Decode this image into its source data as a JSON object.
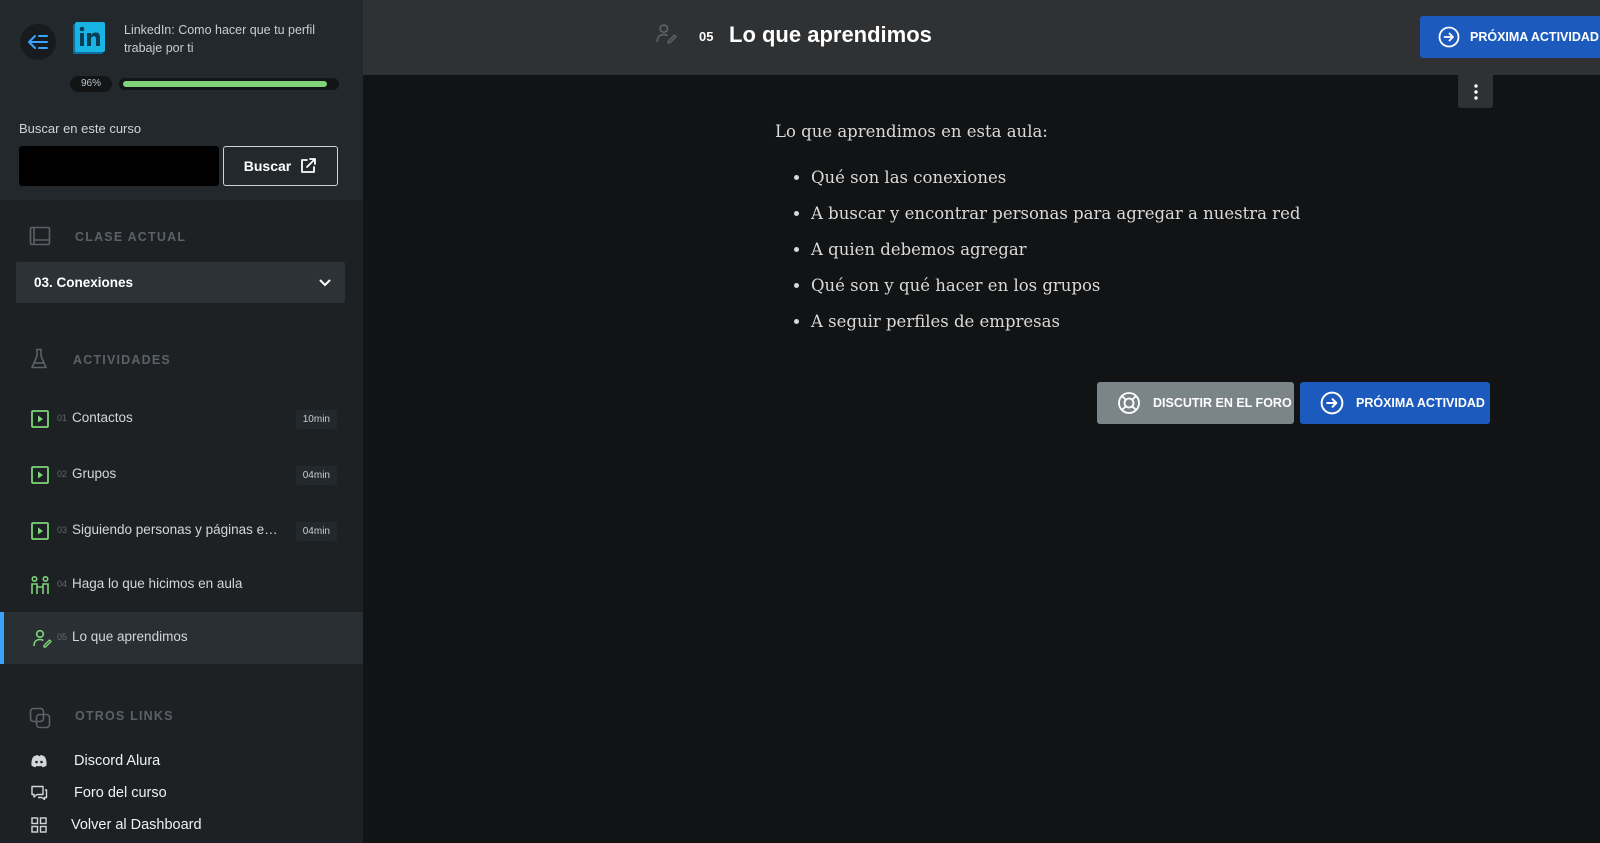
{
  "course": {
    "title": "LinkedIn: Como hacer que tu perfil trabaje por ti",
    "progress_label": "96%",
    "progress_value": 0.96
  },
  "search": {
    "label": "Buscar en este curso",
    "button": "Buscar"
  },
  "current_class": {
    "section_title": "CLASE ACTUAL",
    "selected": "03. Conexiones"
  },
  "activities": {
    "section_title": "ACTIVIDADES",
    "items": [
      {
        "num": "01",
        "name": "Contactos",
        "duration": "10min",
        "icon": "video-icon"
      },
      {
        "num": "02",
        "name": "Grupos",
        "duration": "04min",
        "icon": "video-icon"
      },
      {
        "num": "03",
        "name": "Siguiendo personas y páginas em...",
        "duration": "04min",
        "icon": "video-icon"
      },
      {
        "num": "04",
        "name": "Haga lo que hicimos en aula",
        "duration": "",
        "icon": "practice-icon"
      },
      {
        "num": "05",
        "name": "Lo que aprendimos",
        "duration": "",
        "icon": "learned-icon"
      }
    ]
  },
  "other_links": {
    "section_title": "OTROS LINKS",
    "items": [
      {
        "name": "Discord Alura",
        "icon": "discord-icon"
      },
      {
        "name": "Foro del curso",
        "icon": "forum-icon"
      },
      {
        "name": "Volver al Dashboard",
        "icon": "dashboard-icon"
      }
    ]
  },
  "header": {
    "number": "05",
    "title": "Lo que aprendimos",
    "next_button": "PRÓXIMA ACTIVIDAD"
  },
  "content": {
    "intro": "Lo que aprendimos en esta aula:",
    "bullets": [
      "Qué son las conexiones",
      "A buscar y encontrar personas para agregar a nuestra red",
      "A quien debemos agregar",
      "Qué son y qué hacer en los grupos",
      "A seguir perfiles de empresas"
    ]
  },
  "actions": {
    "forum_button": "DISCUTIR EN EL FORO",
    "next_button": "PRÓXIMA ACTIVIDAD"
  },
  "colors": {
    "accent": "#1c5bbd",
    "progress": "#7ed37b",
    "activity_icon": "#7ed37b",
    "current_marker": "#3aa3ff"
  }
}
